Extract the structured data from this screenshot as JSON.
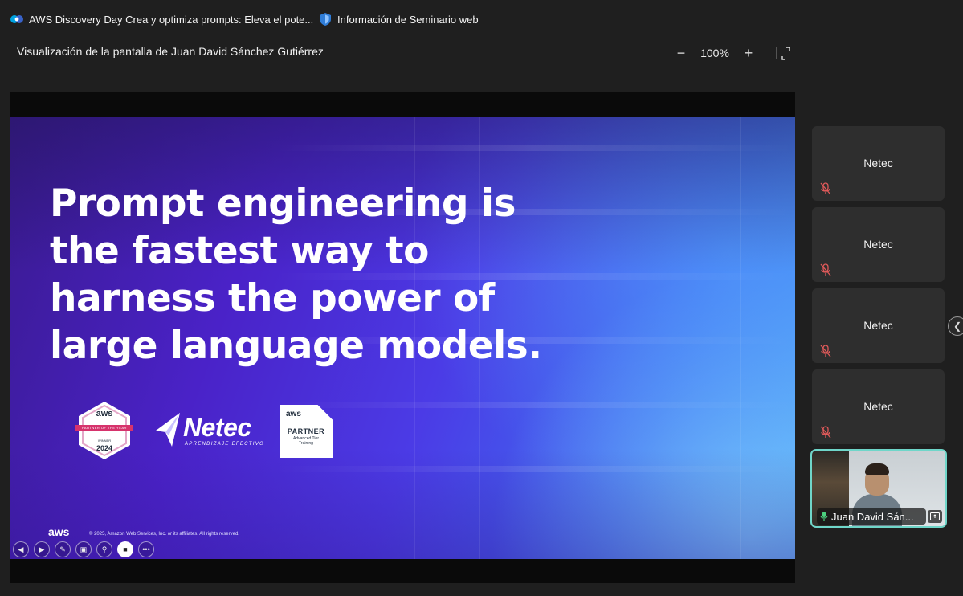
{
  "tabs": [
    {
      "label": "AWS Discovery Day Crea y optimiza prompts: Eleva el pote...",
      "icon": "webex-icon"
    },
    {
      "label": "Información de Seminario web",
      "icon": "shield-icon"
    }
  ],
  "viewer": {
    "title": "Visualización de la pantalla de Juan David Sánchez Gutiérrez",
    "zoom": "100%",
    "zoom_out_label": "−",
    "zoom_in_label": "+"
  },
  "slide": {
    "headline": "Prompt engineering is the fastest way to harness the power of large language models.",
    "logos": {
      "aws_badge_brand": "aws",
      "aws_badge_title": "PARTNER OF THE YEAR",
      "aws_badge_winners": "WINNER",
      "aws_badge_year": "2024",
      "netec_word": "Netec",
      "netec_tagline": "APRENDIZAJE EFECTIVO",
      "partner_brand": "aws",
      "partner_word": "PARTNER",
      "partner_sub1": "Advanced Tier",
      "partner_sub2": "Training"
    },
    "footer_brand": "aws",
    "footer_copyright": "© 2025, Amazon Web Services, Inc. or its affiliates. All rights reserved."
  },
  "participants": [
    {
      "name": "Netec",
      "muted": true
    },
    {
      "name": "Netec",
      "muted": true
    },
    {
      "name": "Netec",
      "muted": true
    },
    {
      "name": "Netec",
      "muted": true
    }
  ],
  "active_speaker": {
    "name": "Juan David Sán..."
  },
  "colors": {
    "speaker_border": "#6fd6c9",
    "muted_mic": "#e05a5a",
    "active_mic": "#4cd07d"
  }
}
